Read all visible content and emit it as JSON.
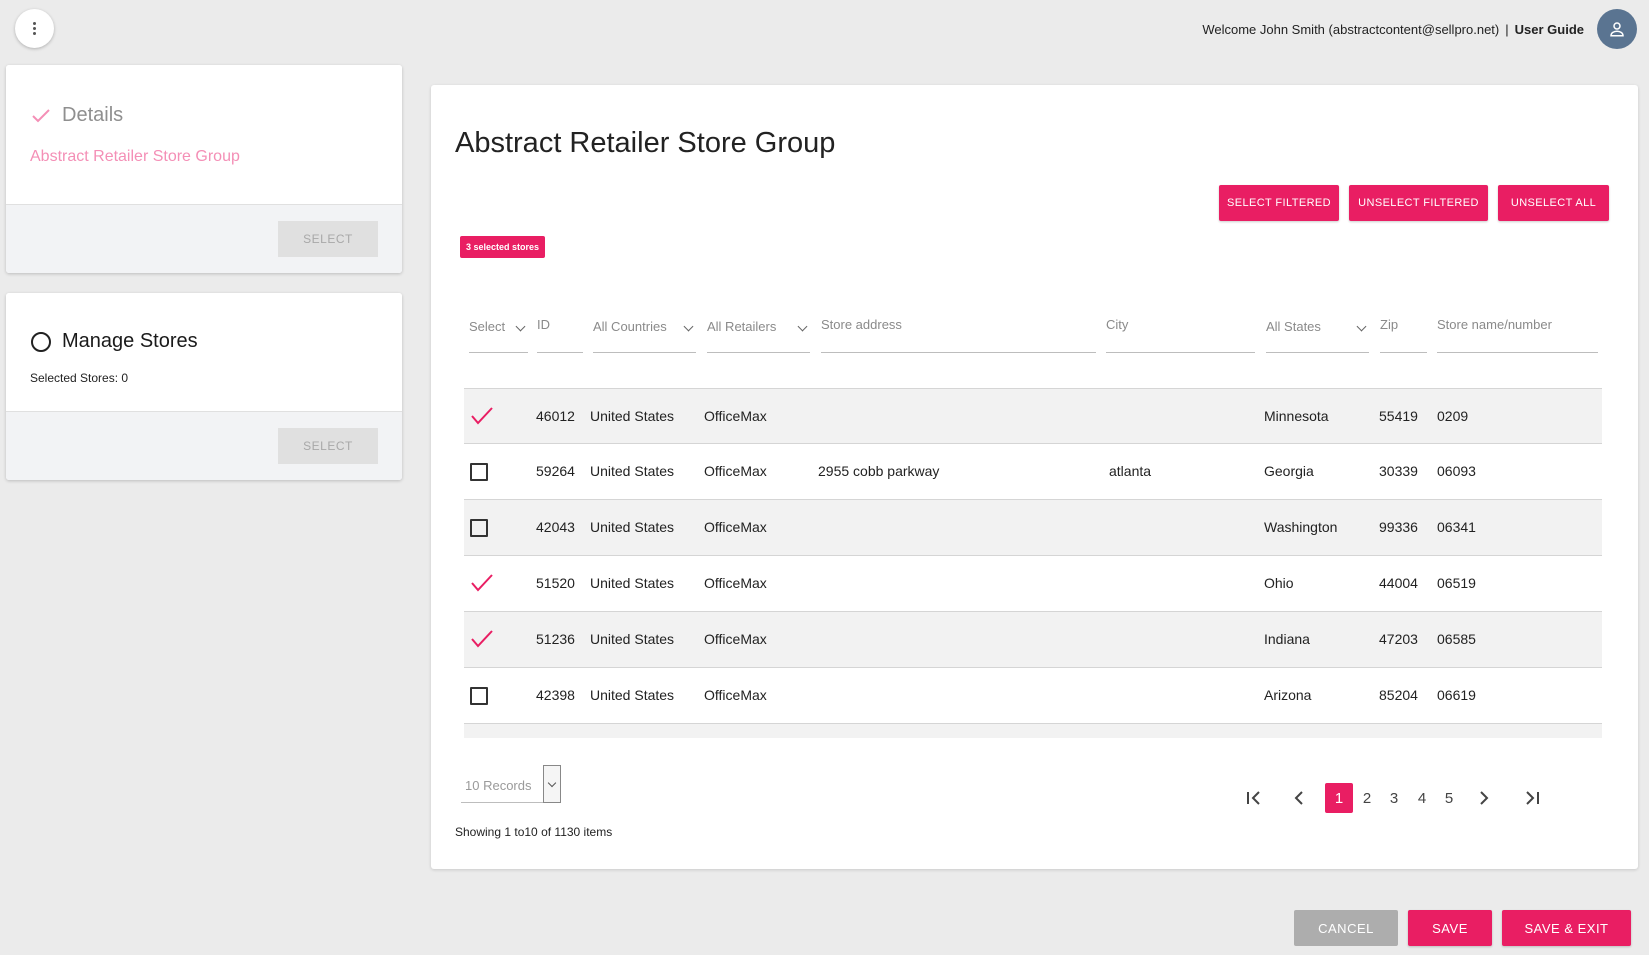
{
  "header": {
    "welcome_text": "Welcome John Smith (abstractcontent@sellpro.net)",
    "separator": "|",
    "user_guide_label": "User Guide"
  },
  "icons": {
    "menu": "more-vertical-icon",
    "avatar": "user-icon",
    "checked": "checkmark-icon",
    "unchecked": "checkbox-empty-icon",
    "step_pending": "circle-outline-icon",
    "first": "first-page-icon",
    "prev": "chevron-left-icon",
    "next": "chevron-right-icon",
    "last": "last-page-icon"
  },
  "colors": {
    "accent": "#e91e63",
    "accent_light": "#f48fb6",
    "background": "#ebebeb",
    "avatar": "#5a7491",
    "disabled": "#e0e0e0"
  },
  "steps": {
    "details": {
      "title": "Details",
      "subtitle": "Abstract Retailer Store Group",
      "select_label": "SELECT"
    },
    "manage_stores": {
      "title": "Manage Stores",
      "count_text": "Selected Stores: 0",
      "select_label": "SELECT"
    }
  },
  "main": {
    "title": "Abstract Retailer Store Group",
    "select_filtered_label": "SELECT FILTERED",
    "unselect_filtered_label": "UNSELECT FILTERED",
    "unselect_all_label": "UNSELECT ALL",
    "selected_badge": "3 selected stores"
  },
  "filters": {
    "select": "Select",
    "id": "ID",
    "countries": "All Countries",
    "retailers": "All Retailers",
    "address": "Store address",
    "city": "City",
    "states": "All States",
    "zip": "Zip",
    "store_name": "Store name/number"
  },
  "rows": [
    {
      "checked": true,
      "id": "46012",
      "country": "United States",
      "retailer": "OfficeMax",
      "address": "",
      "city": "",
      "state": "Minnesota",
      "zip": "55419",
      "store": "0209"
    },
    {
      "checked": false,
      "id": "59264",
      "country": "United States",
      "retailer": "OfficeMax",
      "address": "2955 cobb parkway",
      "city": "atlanta",
      "state": "Georgia",
      "zip": "30339",
      "store": "06093"
    },
    {
      "checked": false,
      "id": "42043",
      "country": "United States",
      "retailer": "OfficeMax",
      "address": "",
      "city": "",
      "state": "Washington",
      "zip": "99336",
      "store": "06341"
    },
    {
      "checked": true,
      "id": "51520",
      "country": "United States",
      "retailer": "OfficeMax",
      "address": "",
      "city": "",
      "state": "Ohio",
      "zip": "44004",
      "store": "06519"
    },
    {
      "checked": true,
      "id": "51236",
      "country": "United States",
      "retailer": "OfficeMax",
      "address": "",
      "city": "",
      "state": "Indiana",
      "zip": "47203",
      "store": "06585"
    },
    {
      "checked": false,
      "id": "42398",
      "country": "United States",
      "retailer": "OfficeMax",
      "address": "",
      "city": "",
      "state": "Arizona",
      "zip": "85204",
      "store": "06619"
    }
  ],
  "pagination": {
    "records_label": "10 Records",
    "showing_text": "Showing 1 to10 of 1130 items",
    "pages": [
      "1",
      "2",
      "3",
      "4",
      "5"
    ],
    "current_page": "1"
  },
  "footer": {
    "cancel_label": "CANCEL",
    "save_label": "SAVE",
    "save_exit_label": "SAVE & EXIT"
  }
}
